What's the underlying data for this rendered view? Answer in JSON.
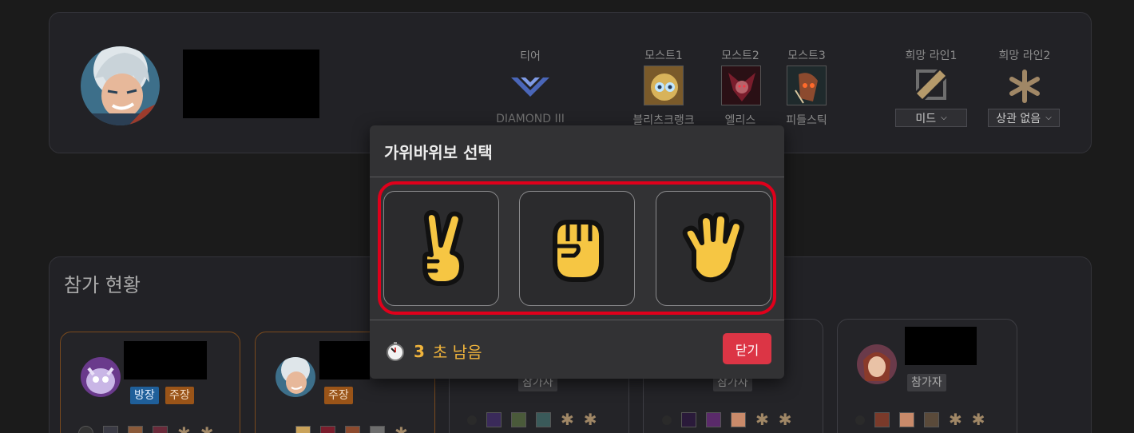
{
  "profile": {
    "tier_label": "티어",
    "tier_value": "DIAMOND III",
    "most": [
      {
        "label": "모스트1",
        "champion": "블리츠크랭크"
      },
      {
        "label": "모스트2",
        "champion": "엘리스"
      },
      {
        "label": "모스트3",
        "champion": "피들스틱"
      }
    ],
    "lanes": [
      {
        "label": "희망 라인1",
        "selected": "미드",
        "icon": "mid-lane-icon"
      },
      {
        "label": "희망 라인2",
        "selected": "상관 없음",
        "icon": "any-lane-icon"
      }
    ]
  },
  "participation": {
    "title": "참가 현황",
    "cards": [
      {
        "badges": [
          "방장",
          "주장"
        ]
      },
      {
        "badges": [
          "주장"
        ]
      },
      {
        "badges": [
          "참가자"
        ]
      },
      {
        "badges": [
          "참가자"
        ]
      },
      {
        "badges": [
          "참가자"
        ]
      }
    ]
  },
  "modal": {
    "title": "가위바위보 선택",
    "choices": [
      {
        "name": "scissors",
        "icon": "victory-hand-icon"
      },
      {
        "name": "rock",
        "icon": "raised-fist-icon"
      },
      {
        "name": "paper",
        "icon": "raised-hand-icon"
      }
    ],
    "timer": {
      "seconds": "3",
      "suffix": "초 남음",
      "icon": "stopwatch-icon"
    },
    "close_label": "닫기"
  },
  "colors": {
    "accent_red": "#dc3545",
    "frame_red": "#e0001b",
    "timer_amber": "#f0b43c",
    "hand_yellow": "#f6c643"
  }
}
